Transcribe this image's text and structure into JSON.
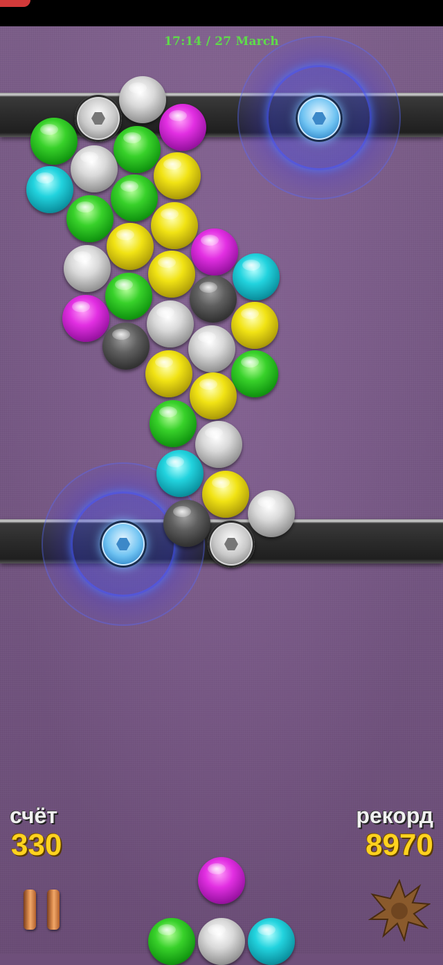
{
  "clock": {
    "text": "17:14 / 27 March"
  },
  "score": {
    "label": "счёт",
    "value": "330"
  },
  "record": {
    "label": "рекорд",
    "value": "8970"
  },
  "colors": {
    "green": "#38d12a",
    "silver": "#d9d9d9",
    "magenta": "#e22fe2",
    "yellow": "#f1e314",
    "cyan": "#22d3de",
    "dark": "#5f5f5f",
    "score_value": "#ffd21f",
    "clock": "#5fdc4a",
    "background": "#745682"
  },
  "icons": {
    "pause": "pause-icon",
    "bomb": "explosion-icon"
  },
  "cluster": [
    "green",
    "silver",
    "magenta",
    "green",
    "silver",
    "green",
    "yellow",
    "cyan",
    "green",
    "yellow",
    "magenta",
    "yellow",
    "silver",
    "yellow",
    "cyan",
    "green",
    "dark",
    "magenta",
    "yellow",
    "silver",
    "silver",
    "dark",
    "yellow",
    "green",
    "yellow",
    "green",
    "silver",
    "cyan",
    "yellow",
    "silver",
    "dark",
    "silver",
    "yellow"
  ],
  "launcher": {
    "current": "magenta",
    "queue": [
      "green",
      "silver",
      "cyan"
    ]
  }
}
